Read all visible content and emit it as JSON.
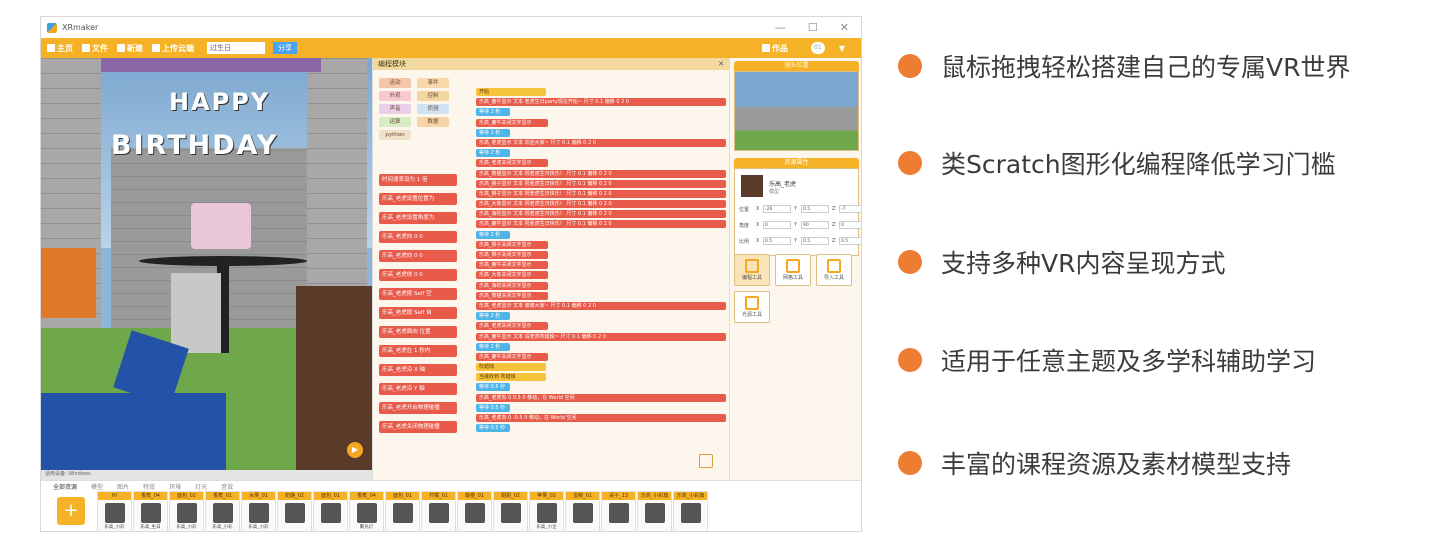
{
  "app": {
    "title": "XRmaker",
    "window_controls": [
      "—",
      "☐",
      "✕"
    ]
  },
  "toolbar": {
    "home": "主页",
    "file": "文件",
    "new": "新建",
    "upload": "上传云端",
    "project_name": "过生日",
    "share": "分享",
    "works": "作品",
    "user": "01"
  },
  "scene": {
    "banner_line1": "HAPPY",
    "banner_line2": "BIRTHDAY",
    "status": "适用设备: Windows"
  },
  "code_panel": {
    "title": "编程模块",
    "close": "✕",
    "categories": [
      {
        "label": "运动",
        "color": "#f7c6a8"
      },
      {
        "label": "事件",
        "color": "#f7d9a8"
      },
      {
        "label": "外观",
        "color": "#f8c9d2"
      },
      {
        "label": "控制",
        "color": "#f4d6a0"
      },
      {
        "label": "声音",
        "color": "#e9cfe8"
      },
      {
        "label": "侦测",
        "color": "#cfe3f4"
      },
      {
        "label": "运算",
        "color": "#d9ecc4"
      },
      {
        "label": "数据",
        "color": "#f7d4a8"
      },
      {
        "label": "python",
        "color": "#efe2c8"
      }
    ],
    "palette_blocks": [
      "时间速率设为 1 倍",
      "乐高_老虎设置位置为",
      "乐高_老虎设置角度为",
      "乐高_老虎向 0 0",
      "乐高_老虎向 0 0",
      "乐高_老虎绕 0 0",
      "乐高_老虎按 Self 空",
      "乐高_老虎按 Self 自",
      "乐高_老虎面向 位置",
      "乐高_老虎在 1 秒内",
      "乐高_老虎沿 X 轴",
      "乐高_老虎沿 Y 轴",
      "乐高_老虎开启物理碰撞",
      "乐高_老虎关闭物理碰撞"
    ],
    "script_blocks": [
      {
        "t": "开始",
        "c": "y"
      },
      {
        "t": "乐高_鹿牛显示 文本 老虎生日party现在开始~ 尺寸 0.1 偏移 0 2 0",
        "c": "r"
      },
      {
        "t": "等待 2 秒",
        "c": "b"
      },
      {
        "t": "乐高_鹿牛关闭文字显示",
        "c": "r"
      },
      {
        "t": "等待 1 秒",
        "c": "b"
      },
      {
        "t": "乐高_老虎显示 文本 欢迎大家~ 尺寸 0.1 偏移 0 2 0",
        "c": "r"
      },
      {
        "t": "等待 2 秒",
        "c": "b"
      },
      {
        "t": "乐高_老虎关闭文字显示",
        "c": "r"
      },
      {
        "t": "乐高_熊猫显示 文本 祝老虎生日快乐！ 尺寸 0.1 偏移 0 2 0",
        "c": "r"
      },
      {
        "t": "乐高_猴子显示 文本 祝老虎生日快乐！ 尺寸 0.1 偏移 0 2 0",
        "c": "r"
      },
      {
        "t": "乐高_狮子显示 文本 祝老虎生日快乐！ 尺寸 0.1 偏移 0 2 0",
        "c": "r"
      },
      {
        "t": "乐高_大象显示 文本 祝老虎生日快乐！ 尺寸 0.1 偏移 0 2 0",
        "c": "r"
      },
      {
        "t": "乐高_海豹显示 文本 祝老虎生日快乐！ 尺寸 0.1 偏移 0 2 0",
        "c": "r"
      },
      {
        "t": "乐高_鹿牛显示 文本 祝老虎生日快乐！ 尺寸 0.1 偏移 0 2 0",
        "c": "r"
      },
      {
        "t": "等待 2 秒",
        "c": "b"
      },
      {
        "t": "乐高_猴子关闭文字显示",
        "c": "r"
      },
      {
        "t": "乐高_狮子关闭文字显示",
        "c": "r"
      },
      {
        "t": "乐高_鹿牛关闭文字显示",
        "c": "r"
      },
      {
        "t": "乐高_大象关闭文字显示",
        "c": "r"
      },
      {
        "t": "乐高_海豹关闭文字显示",
        "c": "r"
      },
      {
        "t": "乐高_熊猫关闭文字显示",
        "c": "r"
      },
      {
        "t": "乐高_老虎显示 文本 谢谢大家~ 尺寸 0.1 偏移 0 2 0",
        "c": "r"
      },
      {
        "t": "等待 2 秒",
        "c": "b"
      },
      {
        "t": "乐高_老虎关闭文字显示",
        "c": "r"
      },
      {
        "t": "乐高_鹿牛显示 文本 请老虎吹蜡烛~ 尺寸 0.1 偏移 0 2 0",
        "c": "r"
      },
      {
        "t": "等待 2 秒",
        "c": "b"
      },
      {
        "t": "乐高_鹿牛关闭文字显示",
        "c": "r"
      },
      {
        "t": "吹蜡烛",
        "c": "y"
      },
      {
        "t": "当接收到 吹蜡烛",
        "c": "y"
      },
      {
        "t": "等待 0.5 秒",
        "c": "b"
      },
      {
        "t": "乐高_老虎向 0 0.5 0 移动，在 World 空间",
        "c": "r"
      },
      {
        "t": "等待 0.5 秒",
        "c": "b"
      },
      {
        "t": "乐高_老虎向 0 -0.5 0 移动，在 World 空间",
        "c": "r"
      },
      {
        "t": "等待 0.5 秒",
        "c": "b"
      }
    ]
  },
  "right_panel": {
    "camera_title": "镜头位置",
    "props_title": "资源属性",
    "obj_name": "乐高_老虎",
    "obj_type": "模型",
    "rows": [
      {
        "label": "位置",
        "x": "-26",
        "y": "0.5",
        "z": "-7"
      },
      {
        "label": "角度",
        "x": "0",
        "y": "90",
        "z": "0"
      },
      {
        "label": "比例",
        "x": "0.5",
        "y": "0.5",
        "z": "0.5"
      }
    ],
    "tools": [
      "编程工具",
      "网格工具",
      "导入工具",
      "光源工具"
    ]
  },
  "assets": {
    "tabs": [
      "全部资源",
      "模型",
      "图片",
      "特效",
      "环境",
      "灯光",
      "音效"
    ],
    "cards": [
      {
        "cap": "Hi",
        "sub": "乐高_小彩"
      },
      {
        "cap": "香蕉_04",
        "sub": "乐高_生日"
      },
      {
        "cap": "面包_02",
        "sub": "乐高_小彩"
      },
      {
        "cap": "香蕉_01",
        "sub": "乐高_小彩"
      },
      {
        "cap": "水果_01",
        "sub": "乐高_小彩"
      },
      {
        "cap": "奶酪_02",
        "sub": ""
      },
      {
        "cap": "面包_01",
        "sub": ""
      },
      {
        "cap": "香蕉_04",
        "sub": "聚光灯"
      },
      {
        "cap": "面包_01",
        "sub": ""
      },
      {
        "cap": "柠檬_01",
        "sub": ""
      },
      {
        "cap": "酸橙_01",
        "sub": ""
      },
      {
        "cap": "甜甜_02",
        "sub": ""
      },
      {
        "cap": "苹果_02",
        "sub": "乐高_小企"
      },
      {
        "cap": "蛋糕_01",
        "sub": ""
      },
      {
        "cap": "桌子_13",
        "sub": ""
      },
      {
        "cap": "乐高_小彩旗",
        "sub": ""
      },
      {
        "cap": "乐高_小彩旗",
        "sub": ""
      }
    ]
  },
  "features": [
    "鼠标拖拽轻松搭建自己的专属VR世界",
    "类Scratch图形化编程降低学习门槛",
    "支持多种VR内容呈现方式",
    "适用于任意主题及多学科辅助学习",
    "丰富的课程资源及素材模型支持"
  ],
  "colors": {
    "accent": "#ed7d31",
    "toolbar": "#f5b227",
    "feature_text": "#3b3b3b"
  }
}
